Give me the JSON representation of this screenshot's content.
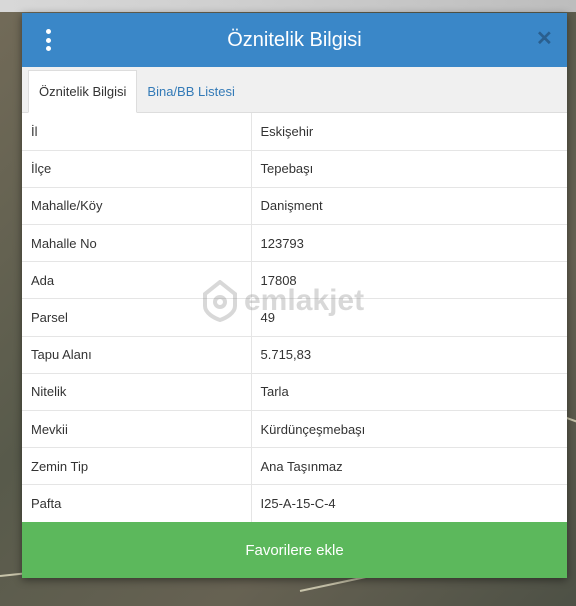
{
  "header": {
    "title": "Öznitelik Bilgisi"
  },
  "tabs": [
    {
      "label": "Öznitelik Bilgisi",
      "active": true
    },
    {
      "label": "Bina/BB Listesi",
      "active": false
    }
  ],
  "rows": [
    {
      "key": "İl",
      "value": "Eskişehir"
    },
    {
      "key": "İlçe",
      "value": "Tepebaşı"
    },
    {
      "key": "Mahalle/Köy",
      "value": "Danişment"
    },
    {
      "key": "Mahalle No",
      "value": "123793"
    },
    {
      "key": "Ada",
      "value": "17808"
    },
    {
      "key": "Parsel",
      "value": "49"
    },
    {
      "key": "Tapu Alanı",
      "value": "5.715,83"
    },
    {
      "key": "Nitelik",
      "value": "Tarla"
    },
    {
      "key": "Mevkii",
      "value": "Kürdünçeşmebaşı"
    },
    {
      "key": "Zemin Tip",
      "value": "Ana Taşınmaz"
    },
    {
      "key": "Pafta",
      "value": "I25-A-15-C-4"
    }
  ],
  "watermark": {
    "text": "emlakjet"
  },
  "footer": {
    "button_label": "Favorilere ekle"
  },
  "colors": {
    "header": "#3a87c8",
    "button": "#5cb85c",
    "tab_link": "#337ab7"
  },
  "icons": {
    "menu": "vertical-dots-icon",
    "close": "close-icon",
    "watermark": "home-pin-icon"
  }
}
